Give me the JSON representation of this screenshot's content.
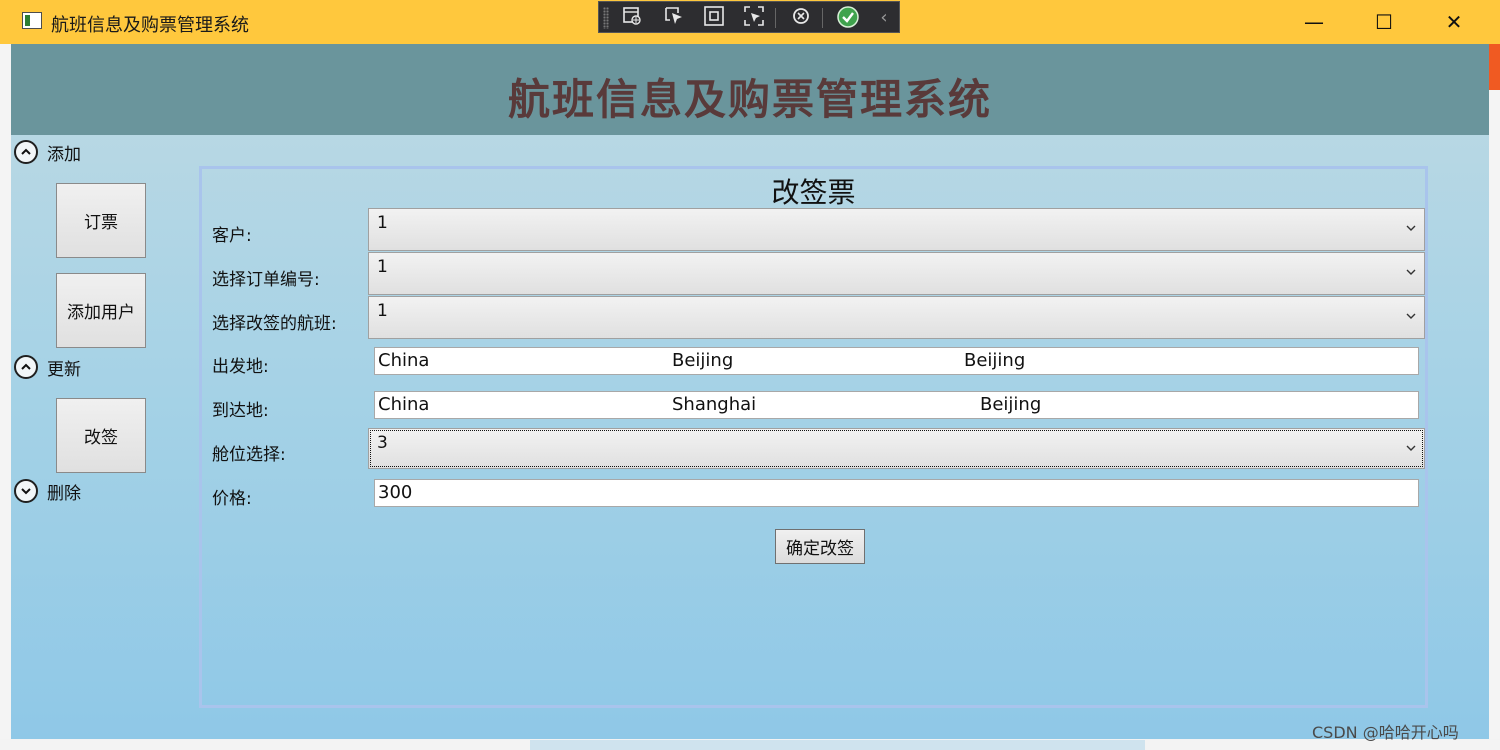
{
  "window": {
    "title": "航班信息及购票管理系统",
    "controls": {
      "minimize": "—",
      "maximize": "☐",
      "close": "✕"
    }
  },
  "header": {
    "title": "航班信息及购票管理系统"
  },
  "nav": {
    "sections": [
      {
        "label": "添加",
        "state": "expanded",
        "buttons": [
          "订票",
          "添加用户"
        ]
      },
      {
        "label": "更新",
        "state": "expanded",
        "buttons": [
          "改签"
        ]
      },
      {
        "label": "删除",
        "state": "collapsed",
        "buttons": []
      }
    ]
  },
  "form": {
    "title": "改签票",
    "customer": {
      "label": "客户:",
      "value": "1"
    },
    "order_no": {
      "label": "选择订单编号:",
      "value": "1"
    },
    "flight": {
      "label": "选择改签的航班:",
      "value": "1"
    },
    "departure": {
      "label": "出发地:",
      "parts": [
        "China",
        "Beijing",
        "Beijing"
      ]
    },
    "arrival": {
      "label": "到达地:",
      "parts": [
        "China",
        "Shanghai",
        "Beijing"
      ]
    },
    "cabin": {
      "label": "舱位选择:",
      "value": "3"
    },
    "price": {
      "label": "价格:",
      "value": "300"
    },
    "confirm_label": "确定改签"
  },
  "watermark": "CSDN @哈哈开心吗",
  "colors": {
    "titlebar": "#ffc83d",
    "header": "#6a959c",
    "header_text": "#593a3a",
    "group_border": "#a9c4ec"
  }
}
